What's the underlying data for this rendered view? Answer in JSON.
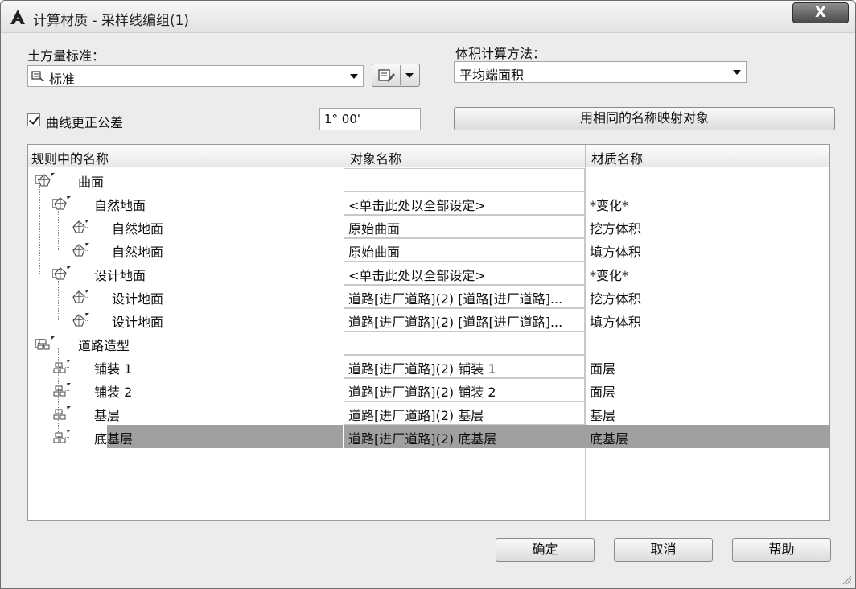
{
  "window": {
    "title": "计算材质 - 采样线编组(1)",
    "close_glyph": "X"
  },
  "earthwork": {
    "label": "土方量标准：",
    "value": "标准"
  },
  "volume_method": {
    "label": "体积计算方法：",
    "value": "平均端面积"
  },
  "curve_correction": {
    "label": "曲线更正公差",
    "checked": true,
    "value": "1° 00'"
  },
  "map_button": {
    "label": "用相同的名称映射对象"
  },
  "grid": {
    "headers": {
      "rule_name": "规则中的名称",
      "object_name": "对象名称",
      "material_name": "材质名称"
    },
    "rows": [
      {
        "name": "曲面",
        "object": "",
        "material": "",
        "icon": "surface-icon",
        "level": 0,
        "expander": true
      },
      {
        "name": "自然地面",
        "object": "<单击此处以全部设定>",
        "material": "*变化*",
        "icon": "surface-icon",
        "level": 1,
        "expander": true
      },
      {
        "name": "自然地面",
        "object": "原始曲面",
        "material": "挖方体积",
        "icon": "surface-icon",
        "level": 2,
        "expander": false
      },
      {
        "name": "自然地面",
        "object": "原始曲面",
        "material": "填方体积",
        "icon": "surface-icon",
        "level": 2,
        "expander": false
      },
      {
        "name": "设计地面",
        "object": "<单击此处以全部设定>",
        "material": "*变化*",
        "icon": "surface-icon",
        "level": 1,
        "expander": true
      },
      {
        "name": "设计地面",
        "object": "道路[进厂道路](2) [道路[进厂道路]...",
        "material": "挖方体积",
        "icon": "surface-icon",
        "level": 2,
        "expander": false
      },
      {
        "name": "设计地面",
        "object": "道路[进厂道路](2) [道路[进厂道路]...",
        "material": "填方体积",
        "icon": "surface-icon",
        "level": 2,
        "expander": false
      },
      {
        "name": "道路造型",
        "object": "",
        "material": "",
        "icon": "corridor-icon",
        "level": 0,
        "expander": true
      },
      {
        "name": "铺装 1",
        "object": "道路[进厂道路](2) 铺装 1",
        "material": "面层",
        "icon": "corridor-icon",
        "level": 1,
        "expander": false
      },
      {
        "name": "铺装 2",
        "object": "道路[进厂道路](2) 铺装 2",
        "material": "面层",
        "icon": "corridor-icon",
        "level": 1,
        "expander": false
      },
      {
        "name": "基层",
        "object": "道路[进厂道路](2) 基层",
        "material": "基层",
        "icon": "corridor-icon",
        "level": 1,
        "expander": false
      },
      {
        "name": "底基层",
        "object": "道路[进厂道路](2) 底基层",
        "material": "底基层",
        "icon": "corridor-icon",
        "level": 1,
        "expander": false,
        "selected": true
      }
    ]
  },
  "buttons": {
    "ok": "确定",
    "cancel": "取消",
    "help": "帮助"
  }
}
